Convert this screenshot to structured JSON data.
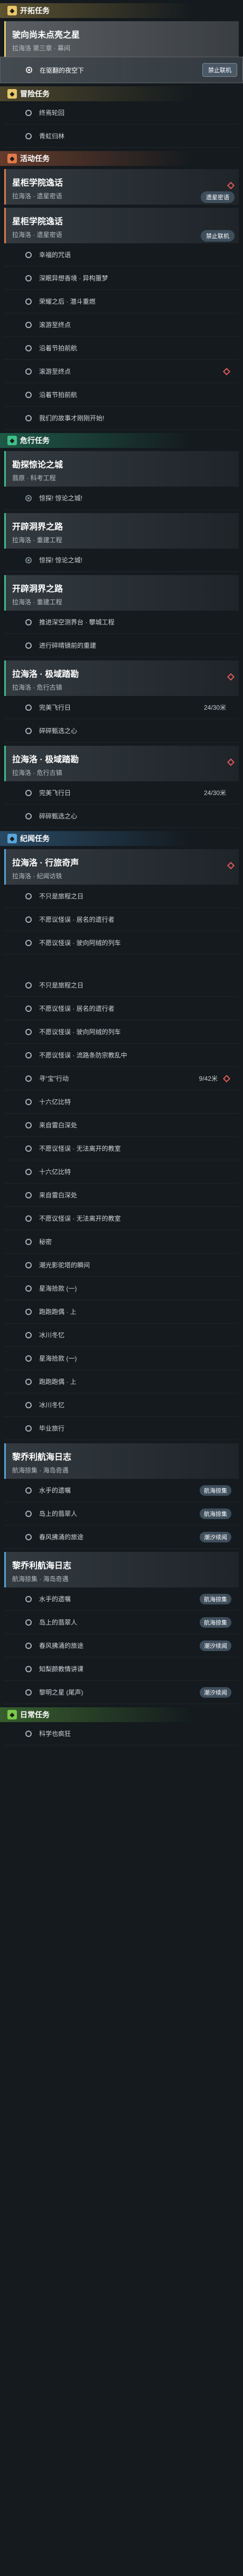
{
  "sections": [
    {
      "title": "开拓任务",
      "icon": "trailblaze-icon",
      "accent": "#e8c86a",
      "accent_bg": "rgba(180,150,70,0.45)",
      "cards": [
        {
          "title": "驶向尚未点亮之星",
          "subtitle": "拉海洛 第三章 · 幕间",
          "selected": true,
          "flag": false,
          "objectives": [
            {
              "text": "在驱翻的夜空下",
              "selected": true,
              "badge": "禁止联机"
            }
          ]
        }
      ]
    },
    {
      "title": "冒险任务",
      "icon": "adventure-icon",
      "accent": "#e8c86a",
      "accent_bg": "rgba(180,150,70,0.35)",
      "cards": [],
      "objectives": [
        {
          "text": "终焉轮回"
        },
        {
          "text": "青虹归林"
        }
      ]
    },
    {
      "title": "活动任务",
      "icon": "event-icon",
      "accent": "#e07a4a",
      "accent_bg": "rgba(200,100,60,0.45)",
      "cards": [
        {
          "title": "星柜学院逸话",
          "subtitle": "拉海洛 · 遗星密语",
          "flag": true,
          "badge": "遗星密语",
          "objectives": []
        },
        {
          "title": "星柜学院逸话",
          "subtitle": "拉海洛 · 遗星密语",
          "flag": false,
          "badge": "禁止联机",
          "objectives": [
            {
              "text": "幸福的咒语"
            },
            {
              "text": "深眠异想香境 · 异构噩梦"
            },
            {
              "text": "荣耀之后 · 潜斗重燃"
            },
            {
              "text": "滚游至终点"
            },
            {
              "text": "沿着节拍前航"
            },
            {
              "text": "滚游至终点",
              "flag": true
            },
            {
              "text": "沿着节拍前航"
            },
            {
              "text": "我们的故事才刚刚开始!"
            }
          ]
        }
      ]
    },
    {
      "title": "危行任务",
      "icon": "dungeon-icon",
      "accent": "#3fbf8a",
      "accent_bg": "rgba(40,150,110,0.5)",
      "cards": [
        {
          "title": "勘探惊论之城",
          "subtitle": "翡原 · 科考工程",
          "selected": false,
          "flag": false,
          "objectives": [
            {
              "text": "惊探! 惊论之城!",
              "done": true
            }
          ]
        },
        {
          "title": "开辟洞界之路",
          "subtitle": "拉海洛 · 重建工程",
          "flag": false,
          "objectives": [
            {
              "text": "惊探! 惊论之城!",
              "done": true
            }
          ]
        },
        {
          "title": "开辟洞界之路",
          "subtitle": "拉海洛 · 重建工程",
          "flag": false,
          "objectives": [
            {
              "text": "推进深空测界台 · 攀城工程"
            },
            {
              "text": "进行碎晴镜前的重建"
            }
          ]
        },
        {
          "title": "拉海洛 · 极域踏勘",
          "subtitle": "拉海洛 · 危行古镇",
          "flag": true,
          "objectives": [
            {
              "text": "完美飞行日",
              "extra": "24/30米"
            },
            {
              "text": "碎碎甄选之心"
            }
          ]
        },
        {
          "title": "拉海洛 · 极域踏勘",
          "subtitle": "拉海洛 · 危行古镇",
          "flag": true,
          "objectives": [
            {
              "text": "完美飞行日",
              "extra": "24/30米"
            },
            {
              "text": "碎碎甄选之心"
            }
          ]
        }
      ]
    },
    {
      "title": "纪闻任务",
      "icon": "chronicle-icon",
      "accent": "#5aa6d8",
      "accent_bg": "rgba(60,120,170,0.5)",
      "cards": [
        {
          "title": "拉海洛 · 行旅奇声",
          "subtitle": "拉海洛 · 纪闻访轶",
          "flag": true,
          "objectives": [
            {
              "text": "不只是旅程之日"
            },
            {
              "text": "不愿议怪误 · 居名的遗行者"
            },
            {
              "text": "不愿议怪误 · 驶向阿绒的列车"
            }
          ]
        },
        {
          "title": "",
          "subtitle": "",
          "flag": false,
          "header_hidden": true,
          "objectives": [
            {
              "text": "不只是旅程之日"
            },
            {
              "text": "不愿议怪误 · 居名的遗行者"
            },
            {
              "text": "不愿议怪误 · 驶向阿绒的列车"
            },
            {
              "text": "不愿议怪误 · 流路条防宗教乱中"
            },
            {
              "text": "寻“宝”行动",
              "extra": "9/42米",
              "flag": true
            },
            {
              "text": "十六亿比特"
            },
            {
              "text": "来自雷白深处"
            },
            {
              "text": "不愿议怪误 · 无法离开的教室"
            },
            {
              "text": "十六亿比特"
            },
            {
              "text": "来自雷白深处"
            },
            {
              "text": "不愿议怪误 · 无法离开的教室"
            },
            {
              "text": "秘密"
            },
            {
              "text": "潮光影驼塔的瞬间"
            },
            {
              "text": "星海拾款 (一)"
            },
            {
              "text": "跑跑跑偶 · 上"
            },
            {
              "text": "冰川冬忆"
            },
            {
              "text": "星海拾款 (一)"
            },
            {
              "text": "跑跑跑偶 · 上"
            },
            {
              "text": "冰川冬忆"
            },
            {
              "text": "毕业旅行"
            }
          ]
        },
        {
          "title": "黎乔利航海日志",
          "subtitle": "航海掠集 · 海岛奇遇",
          "flag": false,
          "objectives": [
            {
              "text": "水手的遗嘱",
              "badge": "航海掠集"
            },
            {
              "text": "岛上的翡翠人",
              "badge": "航海掠集"
            },
            {
              "text": "春风拂涌的旅途",
              "badge": "潮汐续闻"
            }
          ]
        },
        {
          "title": "黎乔利航海日志",
          "subtitle": "航海掠集 · 海岛奇遇",
          "flag": false,
          "objectives": [
            {
              "text": "水手的遗嘱",
              "badge": "航海掠集"
            },
            {
              "text": "岛上的翡翠人",
              "badge": "航海掠集"
            },
            {
              "text": "春风拂涌的旅途",
              "badge": "潮汐续闻"
            },
            {
              "text": "知梨颜教情讲课"
            },
            {
              "text": "黎明之星 (尾声)",
              "badge": "潮汐续闻"
            }
          ]
        }
      ]
    },
    {
      "title": "日常任务",
      "icon": "daily-icon",
      "accent": "#7ac84a",
      "accent_bg": "rgba(90,160,60,0.5)",
      "cards": [],
      "objectives": [
        {
          "text": "科学也疯狂"
        }
      ]
    }
  ]
}
